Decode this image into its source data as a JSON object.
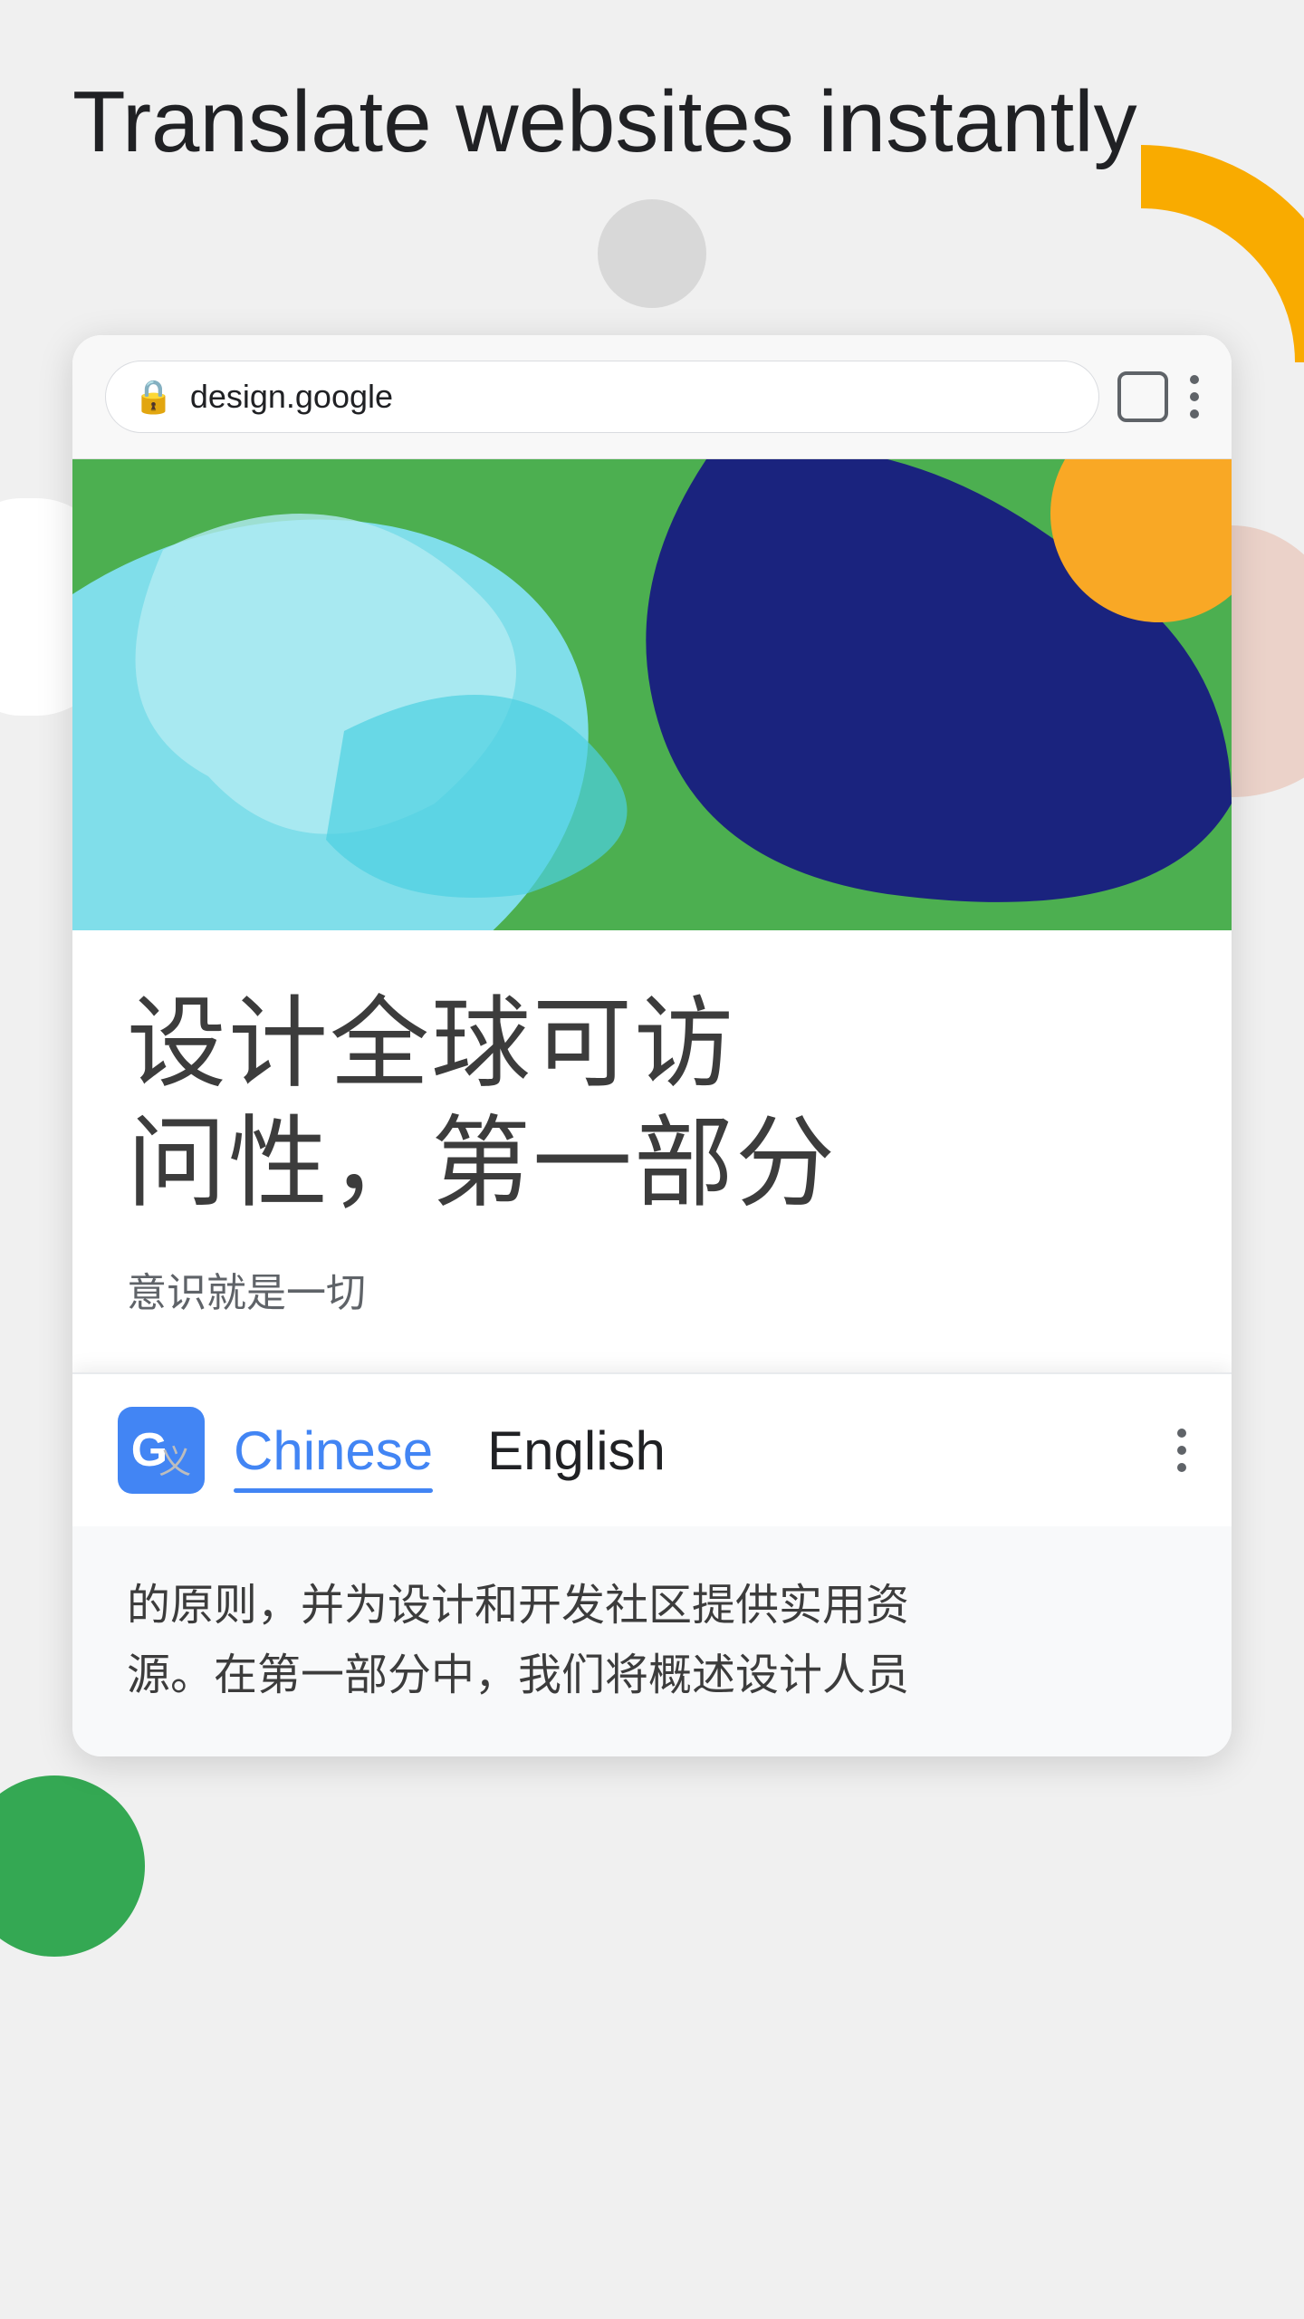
{
  "hero": {
    "title": "Translate websites instantly"
  },
  "browser": {
    "url": "design.google",
    "tab_icon_label": "tab",
    "menu_label": "menu"
  },
  "website": {
    "chinese_headline": "设计全球可访\n问性，第一部分",
    "chinese_headline_line1": "设计全球可访",
    "chinese_headline_line2": "问性，第一部分",
    "chinese_subtitle": "意识就是一切"
  },
  "translate_bar": {
    "icon_letter": "G",
    "icon_x": "义",
    "language_source": "Chinese",
    "language_target": "English"
  },
  "bottom_text": {
    "line1": "的原则，并为设计和开发社区提供实用资",
    "line2": "源。在第一部分中，我们将概述设计人员"
  }
}
